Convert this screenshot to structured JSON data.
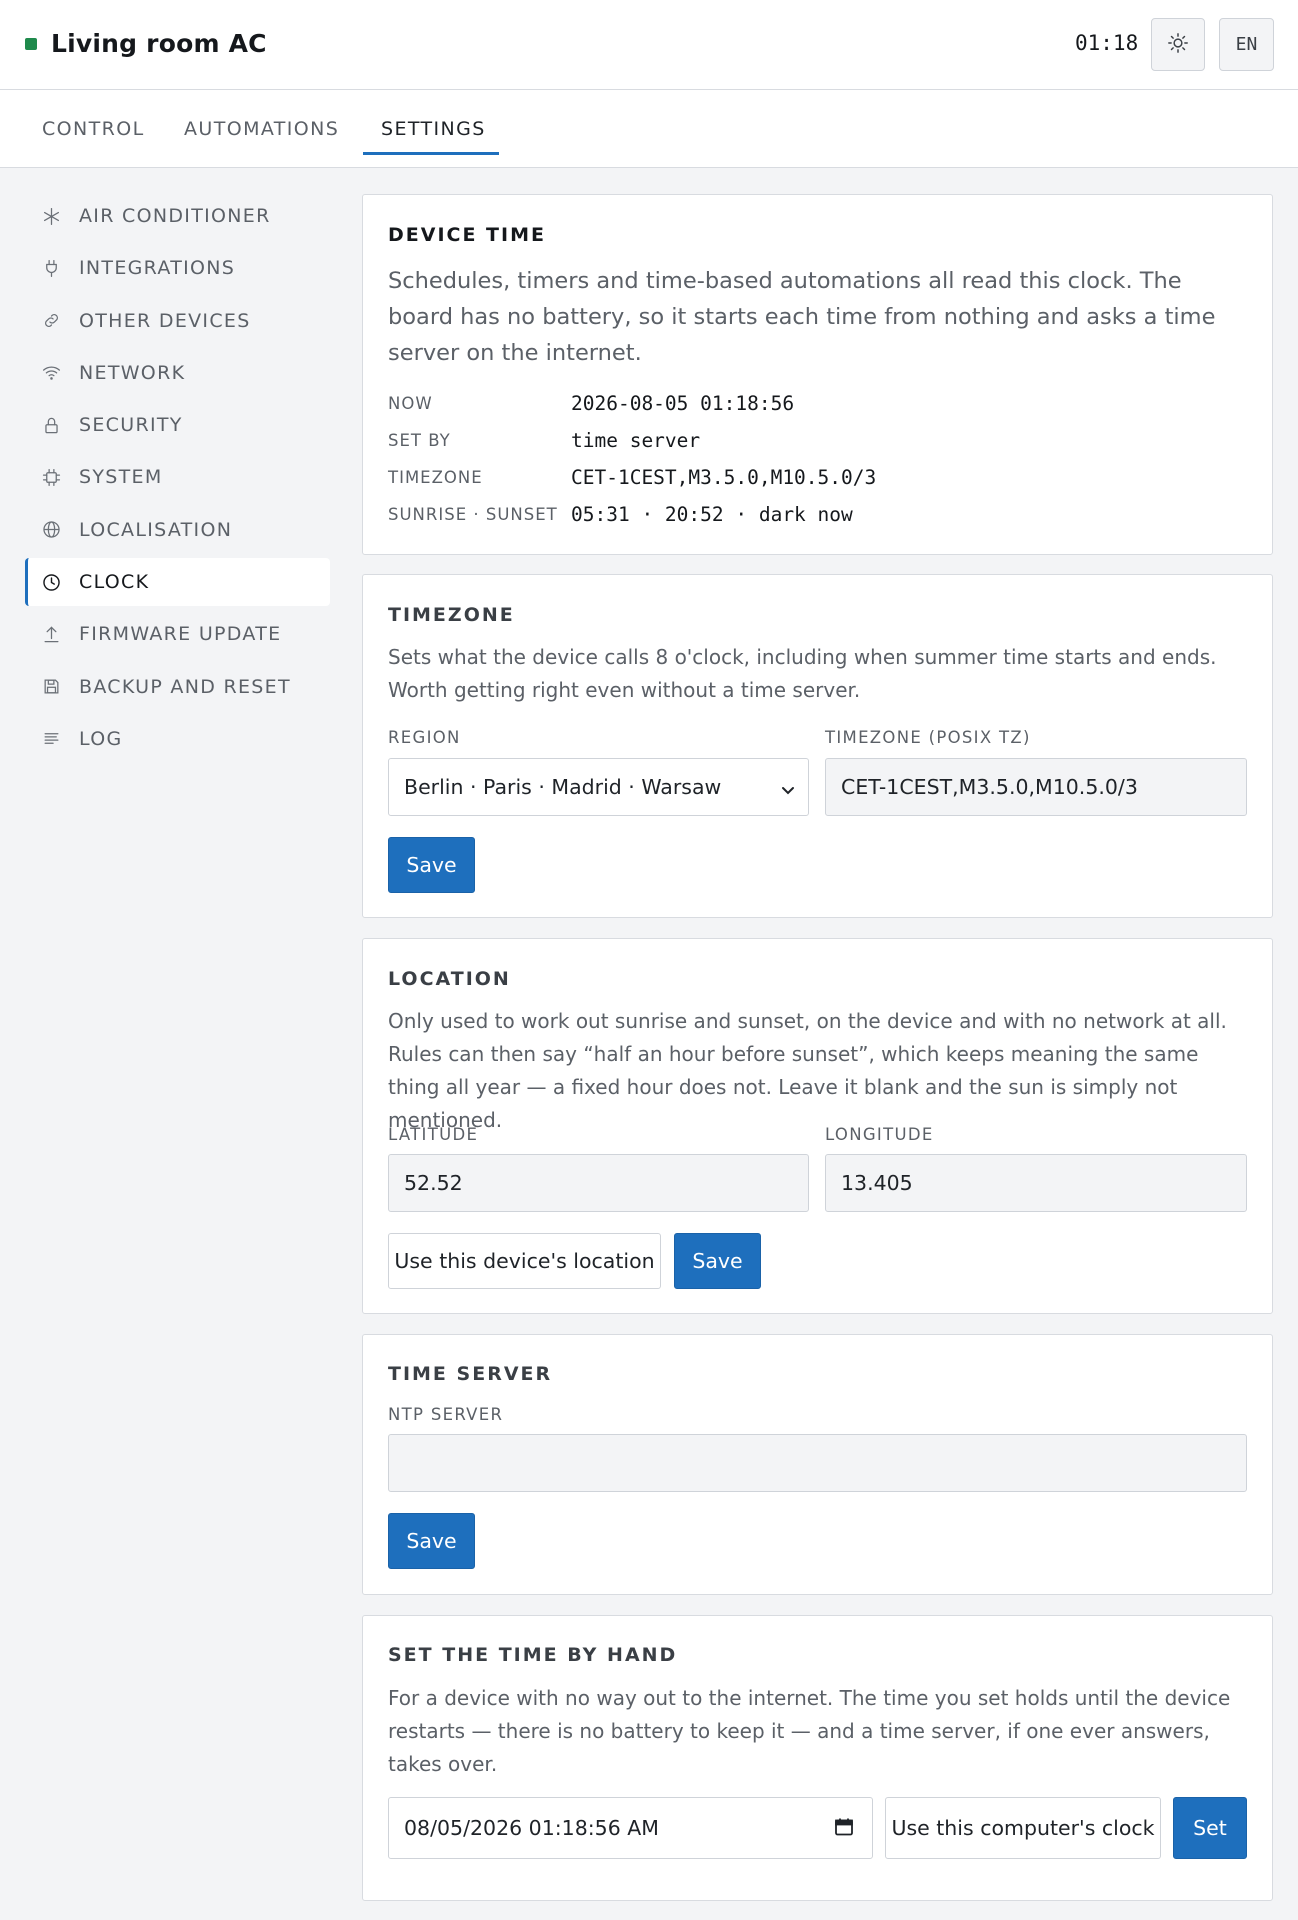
{
  "header": {
    "title": "Living room AC",
    "status_color": "#1f8a4c",
    "clock": "01:18",
    "theme_icon": "sun-icon",
    "language": "EN"
  },
  "tabs": [
    {
      "label": "CONTROL",
      "active": false
    },
    {
      "label": "AUTOMATIONS",
      "active": false
    },
    {
      "label": "SETTINGS",
      "active": true
    }
  ],
  "sidebar": {
    "items": [
      {
        "label": "AIR CONDITIONER",
        "icon": "snowflake-icon",
        "active": false
      },
      {
        "label": "INTEGRATIONS",
        "icon": "plug-icon",
        "active": false
      },
      {
        "label": "OTHER DEVICES",
        "icon": "link-icon",
        "active": false
      },
      {
        "label": "NETWORK",
        "icon": "wifi-icon",
        "active": false
      },
      {
        "label": "SECURITY",
        "icon": "lock-icon",
        "active": false
      },
      {
        "label": "SYSTEM",
        "icon": "chip-icon",
        "active": false
      },
      {
        "label": "LOCALISATION",
        "icon": "globe-icon",
        "active": false
      },
      {
        "label": "CLOCK",
        "icon": "clock-icon",
        "active": true
      },
      {
        "label": "FIRMWARE UPDATE",
        "icon": "upload-icon",
        "active": false
      },
      {
        "label": "BACKUP AND RESET",
        "icon": "save-icon",
        "active": false
      },
      {
        "label": "LOG",
        "icon": "list-icon",
        "active": false
      }
    ]
  },
  "device_time": {
    "title": "DEVICE TIME",
    "description": "Schedules, timers and time-based automations all read this clock. The board has no battery, so it starts each time from nothing and asks a time server on the internet.",
    "rows": [
      {
        "key": "NOW",
        "value": "2026-08-05 01:18:56"
      },
      {
        "key": "SET BY",
        "value": "time server"
      },
      {
        "key": "TIMEZONE",
        "value": "CET-1CEST,M3.5.0,M10.5.0/3"
      },
      {
        "key": "SUNRISE · SUNSET",
        "value": "05:31 · 20:52 · dark now"
      }
    ]
  },
  "timezone": {
    "title": "TIMEZONE",
    "description": "Sets what the device calls 8 o'clock, including when summer time starts and ends. Worth getting right even without a time server.",
    "region_label": "REGION",
    "region_value": "Berlin · Paris · Madrid · Warsaw",
    "posix_label": "TIMEZONE (POSIX TZ)",
    "posix_value": "CET-1CEST,M3.5.0,M10.5.0/3",
    "save_label": "Save"
  },
  "location": {
    "title": "LOCATION",
    "description": "Only used to work out sunrise and sunset, on the device and with no network at all. Rules can then say “half an hour before sunset”, which keeps meaning the same thing all year — a fixed hour does not. Leave it blank and the sun is simply not mentioned.",
    "latitude_label": "LATITUDE",
    "latitude_value": "52.52",
    "longitude_label": "LONGITUDE",
    "longitude_value": "13.405",
    "use_location_label": "Use this device's location",
    "save_label": "Save"
  },
  "time_server": {
    "title": "TIME SERVER",
    "ntp_label": "NTP SERVER",
    "ntp_value": "",
    "save_label": "Save"
  },
  "manual_time": {
    "title": "SET THE TIME BY HAND",
    "description": "For a device with no way out to the internet. The time you set holds until the device restarts — there is no battery to keep it — and a time server, if one ever answers, takes over.",
    "datetime_value": "08/05/2026 01:18:56 AM",
    "use_computer_label": "Use this computer's clock",
    "set_label": "Set"
  }
}
